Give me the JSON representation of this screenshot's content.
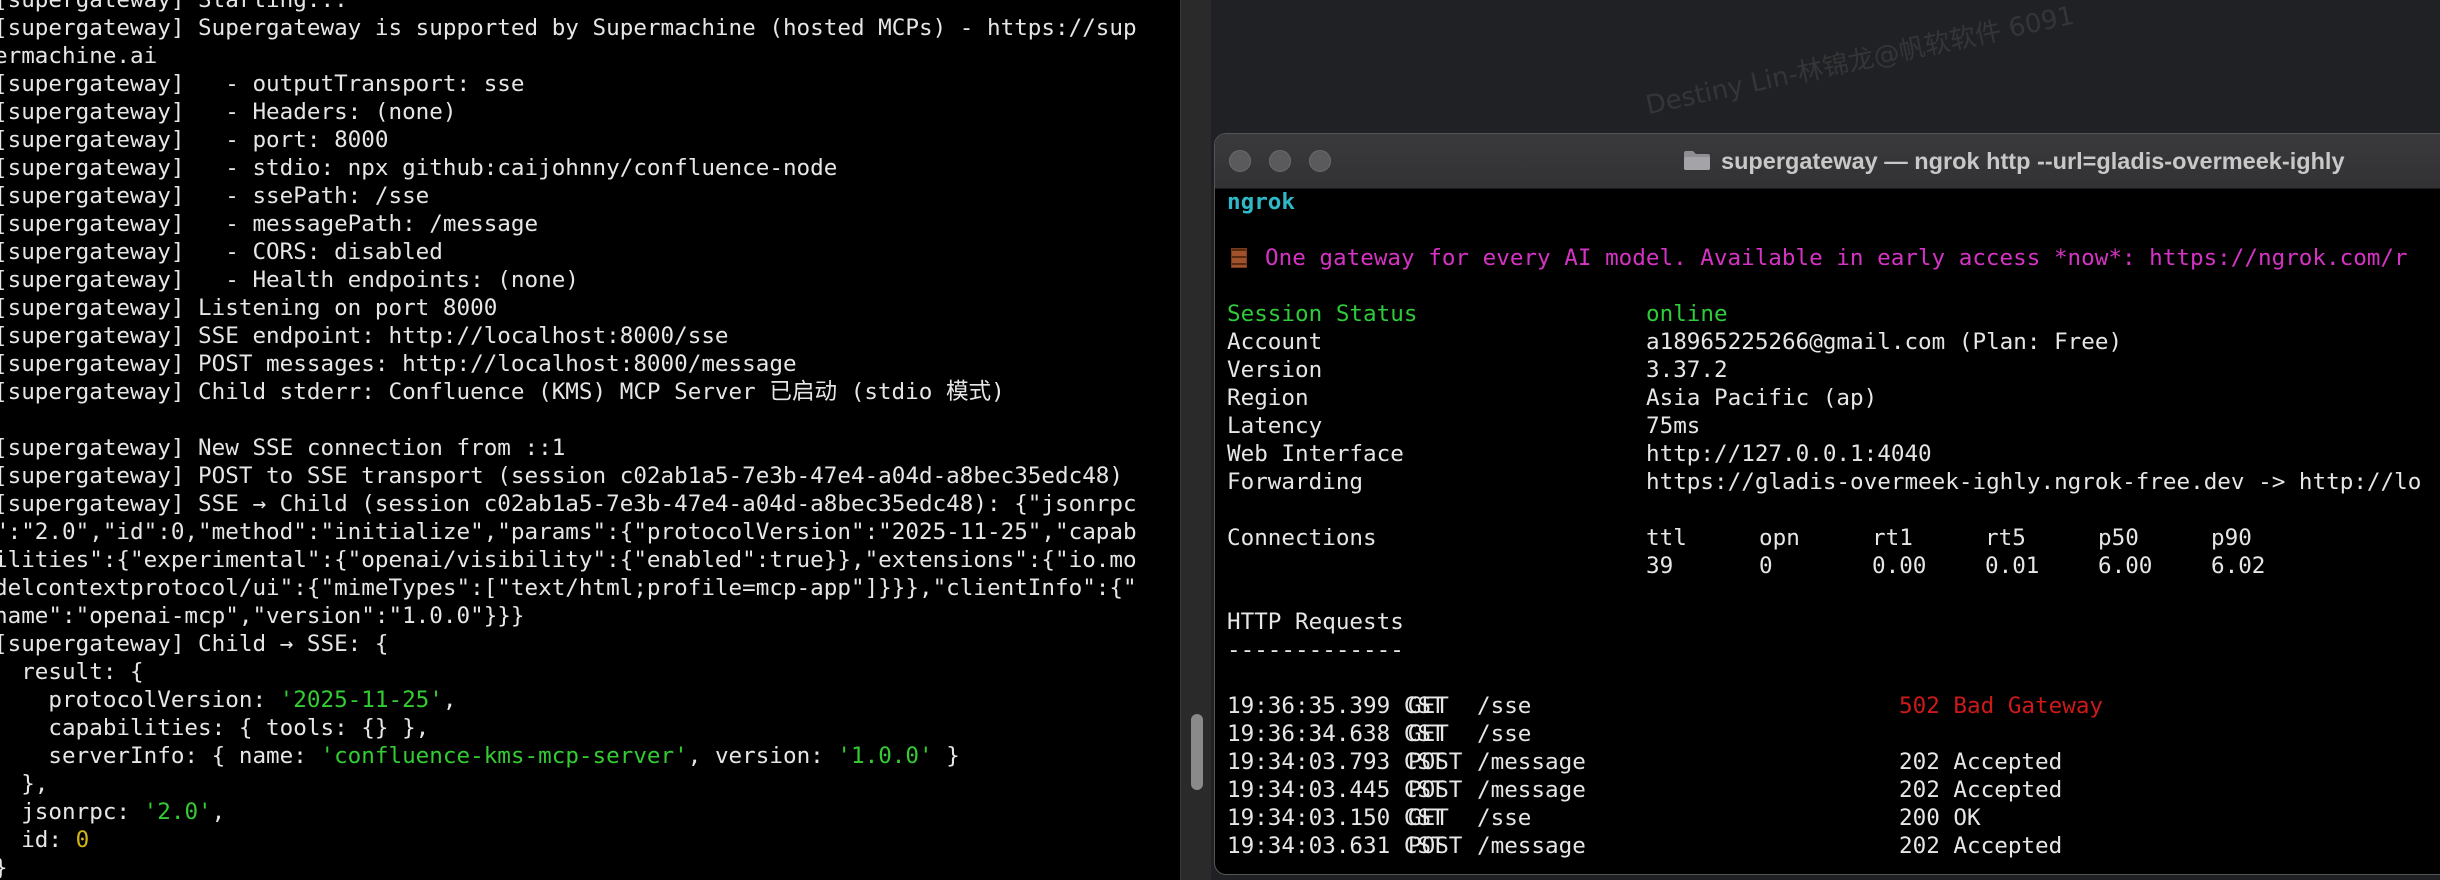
{
  "left_terminal": {
    "lines": [
      [
        {
          "t": "[supergateway] Starting..."
        }
      ],
      [
        {
          "t": "[supergateway] Supergateway is supported by Supermachine (hosted MCPs) - https://sup"
        }
      ],
      [
        {
          "t": "ermachine.ai"
        }
      ],
      [
        {
          "t": "[supergateway]   - outputTransport: sse"
        }
      ],
      [
        {
          "t": "[supergateway]   - Headers: (none)"
        }
      ],
      [
        {
          "t": "[supergateway]   - port: 8000"
        }
      ],
      [
        {
          "t": "[supergateway]   - stdio: npx github:caijohnny/confluence-node"
        }
      ],
      [
        {
          "t": "[supergateway]   - ssePath: /sse"
        }
      ],
      [
        {
          "t": "[supergateway]   - messagePath: /message"
        }
      ],
      [
        {
          "t": "[supergateway]   - CORS: disabled"
        }
      ],
      [
        {
          "t": "[supergateway]   - Health endpoints: (none)"
        }
      ],
      [
        {
          "t": "[supergateway] Listening on port 8000"
        }
      ],
      [
        {
          "t": "[supergateway] SSE endpoint: http://localhost:8000/sse"
        }
      ],
      [
        {
          "t": "[supergateway] POST messages: http://localhost:8000/message"
        }
      ],
      [
        {
          "t": "[supergateway] Child stderr: Confluence (KMS) MCP Server 已启动 (stdio 模式)"
        }
      ],
      [
        {
          "t": ""
        }
      ],
      [
        {
          "t": "[supergateway] New SSE connection from ::1"
        }
      ],
      [
        {
          "t": "[supergateway] POST to SSE transport (session c02ab1a5-7e3b-47e4-a04d-a8bec35edc48)"
        }
      ],
      [
        {
          "t": "[supergateway] SSE → Child (session c02ab1a5-7e3b-47e4-a04d-a8bec35edc48): {\"jsonrpc"
        }
      ],
      [
        {
          "t": "\":\"2.0\",\"id\":0,\"method\":\"initialize\",\"params\":{\"protocolVersion\":\"2025-11-25\",\"capab"
        }
      ],
      [
        {
          "t": "ilities\":{\"experimental\":{\"openai/visibility\":{\"enabled\":true}},\"extensions\":{\"io.mo"
        }
      ],
      [
        {
          "t": "delcontextprotocol/ui\":{\"mimeTypes\":[\"text/html;profile=mcp-app\"]}}},\"clientInfo\":{\""
        }
      ],
      [
        {
          "t": "name\":\"openai-mcp\",\"version\":\"1.0.0\"}}}"
        }
      ],
      [
        {
          "t": "[supergateway] Child → SSE: {"
        }
      ],
      [
        {
          "t": "  result: {"
        }
      ],
      [
        {
          "t": "    protocolVersion: "
        },
        {
          "t": "'2025-11-25'",
          "c": "str"
        },
        {
          "t": ","
        }
      ],
      [
        {
          "t": "    capabilities: { tools: {} },"
        }
      ],
      [
        {
          "t": "    serverInfo: { name: "
        },
        {
          "t": "'confluence-kms-mcp-server'",
          "c": "str"
        },
        {
          "t": ", version: "
        },
        {
          "t": "'1.0.0'",
          "c": "str"
        },
        {
          "t": " }"
        }
      ],
      [
        {
          "t": "  },"
        }
      ],
      [
        {
          "t": "  jsonrpc: "
        },
        {
          "t": "'2.0'",
          "c": "str"
        },
        {
          "t": ","
        }
      ],
      [
        {
          "t": "  id: "
        },
        {
          "t": "0",
          "c": "num"
        }
      ],
      [
        {
          "t": "}"
        }
      ]
    ]
  },
  "watermark": "Destiny Lin-林锦龙@帆软软件 6091",
  "ngrok_window": {
    "title": "supergateway — ngrok http --url=gladis-overmeek-ighly",
    "brand": "ngrok",
    "promo": "One gateway for every AI model. Available in early access *now*: https://ngrok.com/r",
    "session": [
      {
        "label": "Session Status",
        "value": "online",
        "label_color": "green",
        "value_color": "green"
      },
      {
        "label": "Account",
        "value": "a18965225266@gmail.com (Plan: Free)"
      },
      {
        "label": "Version",
        "value": "3.37.2"
      },
      {
        "label": "Region",
        "value": "Asia Pacific (ap)"
      },
      {
        "label": "Latency",
        "value": "75ms"
      },
      {
        "label": "Web Interface",
        "value": "http://127.0.0.1:4040"
      },
      {
        "label": "Forwarding",
        "value": "https://gladis-overmeek-ighly.ngrok-free.dev -> http://lo"
      }
    ],
    "connections": {
      "label": "Connections",
      "headers": [
        "ttl",
        "opn",
        "rt1",
        "rt5",
        "p50",
        "p90"
      ],
      "values": [
        "39",
        "0",
        "0.00",
        "0.01",
        "6.00",
        "6.02"
      ]
    },
    "http_requests_title": "HTTP Requests",
    "http_requests_rule": "-------------",
    "requests": [
      {
        "time": "19:36:35.399 CST",
        "method": "GET",
        "path": "/sse",
        "status": "502 Bad Gateway",
        "status_color": "red"
      },
      {
        "time": "19:36:34.638 CST",
        "method": "GET",
        "path": "/sse",
        "status": ""
      },
      {
        "time": "19:34:03.793 CST",
        "method": "POST",
        "path": "/message",
        "status": "202 Accepted"
      },
      {
        "time": "19:34:03.445 CST",
        "method": "POST",
        "path": "/message",
        "status": "202 Accepted"
      },
      {
        "time": "19:34:03.150 CST",
        "method": "GET",
        "path": "/sse",
        "status": "200 OK"
      },
      {
        "time": "19:34:03.631 CST",
        "method": "POST",
        "path": "/message",
        "status": "202 Accepted"
      }
    ]
  }
}
